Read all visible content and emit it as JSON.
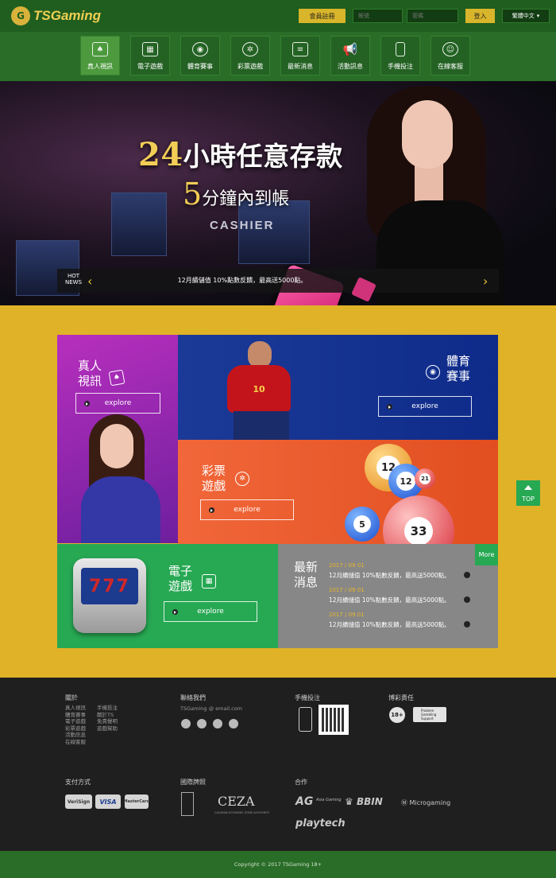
{
  "brand": {
    "name": "TSGaming"
  },
  "header": {
    "register_label": "會員註冊",
    "account_placeholder": "帳號",
    "password_placeholder": "密碼",
    "login_label": "登入",
    "language_label": "繁體中文"
  },
  "nav": {
    "items": [
      {
        "label": "真人視訊",
        "icon": "cards-icon"
      },
      {
        "label": "電子遊戲",
        "icon": "slot-machine-icon"
      },
      {
        "label": "體育賽事",
        "icon": "soccer-ball-icon"
      },
      {
        "label": "彩票遊戲",
        "icon": "lottery-wheel-icon"
      },
      {
        "label": "最新消息",
        "icon": "newspaper-icon"
      },
      {
        "label": "活動訊息",
        "icon": "megaphone-icon"
      },
      {
        "label": "手機投注",
        "icon": "mobile-phone-icon"
      },
      {
        "label": "在線客服",
        "icon": "customer-service-icon"
      }
    ]
  },
  "hero": {
    "headline_num": "24",
    "headline_text": "小時任意存款",
    "subline_num": "5",
    "subline_text": "分鐘內到帳",
    "sign_text": "CASHIER"
  },
  "hot_news": {
    "badge_line1": "HOT",
    "badge_line2": "NEWS",
    "text": "12月續儲值 10%點數反饋，最高送5000點。"
  },
  "tiles": {
    "live": {
      "title_line1": "真人",
      "title_line2": "視訊",
      "button": "explore"
    },
    "sports": {
      "title_line1": "體育",
      "title_line2": "賽事",
      "button": "explore",
      "player_number": "10"
    },
    "lottery": {
      "title_line1": "彩票",
      "title_line2": "遊戲",
      "button": "explore",
      "balls": [
        "12",
        "12",
        "21",
        "5",
        "33"
      ]
    },
    "slots": {
      "title_line1": "電子",
      "title_line2": "遊戲",
      "button": "explore",
      "reels": "777"
    },
    "news": {
      "title_line1": "最新",
      "title_line2": "消息",
      "more_label": "More",
      "items": [
        {
          "date": "2017 / 09 01",
          "text": "12月續儲值 10%點數反饋，最高送5000點。"
        },
        {
          "date": "2017 / 09 01",
          "text": "12月續儲值 10%點數反饋，最高送5000點。"
        },
        {
          "date": "2017 / 09 01",
          "text": "12月續儲值 10%點數反饋，最高送5000點。"
        }
      ]
    }
  },
  "top_button": "TOP",
  "footer": {
    "about": {
      "heading": "關於",
      "col1": [
        "真人視訊",
        "體育賽事",
        "電子遊戲",
        "彩票遊戲",
        "活動訊息",
        "在線客服"
      ],
      "col2": [
        "手機投注",
        "關於TS",
        "免責聲明",
        "遊戲幫助"
      ]
    },
    "contact": {
      "heading": "聯絡我們",
      "email": "TSGaming @ email.com"
    },
    "mobile": {
      "heading": "手機投注"
    },
    "responsible": {
      "heading": "博彩責任",
      "age": "18+",
      "support_line1": "Problem",
      "support_line2": "Gambling",
      "support_line3": "Support"
    },
    "payment": {
      "heading": "支付方式",
      "methods": [
        "VeriSign",
        "VISA",
        "MasterCard"
      ]
    },
    "license": {
      "heading": "國際牌照",
      "ceza": "CEZA",
      "ceza_sub": "CAGAYAN ECONOMIC ZONE AUTHORITY"
    },
    "partners": {
      "heading": "合作",
      "names": [
        "AG",
        "BBIN",
        "Microgaming",
        "playtech"
      ],
      "ag_sub": "Asia Gaming"
    }
  },
  "copyright": "Copyright © 2017 TSGaming 18+"
}
